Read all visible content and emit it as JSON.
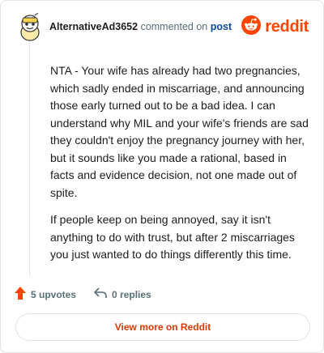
{
  "comment": {
    "username": "AlternativeAd3652",
    "commented_on": "commented on",
    "post_link": "post",
    "paragraphs": [
      "NTA - Your wife has already had two pregnancies, which sadly ended in miscarriage, and announcing those early turned out to be a bad idea. I can understand why MIL and your wife's friends are sad they couldn't enjoy the pregnancy journey with her, but it sounds like you made a rational, based in facts and evidence decision, not one made out of spite.",
      "If people keep on being annoyed, say it isn't anything to do with trust, but after 2 miscarriages you just wanted to do things differently this time."
    ]
  },
  "brand": {
    "name": "reddit",
    "color": "#ff4500"
  },
  "actions": {
    "upvotes": "5 upvotes",
    "replies": "0 replies"
  },
  "footer": {
    "view_more": "View more on Reddit"
  },
  "icons": {
    "avatar": "snoo-avatar-icon",
    "logo": "reddit-logo-icon",
    "upvote": "upvote-arrow-icon",
    "reply": "reply-arrow-icon"
  }
}
